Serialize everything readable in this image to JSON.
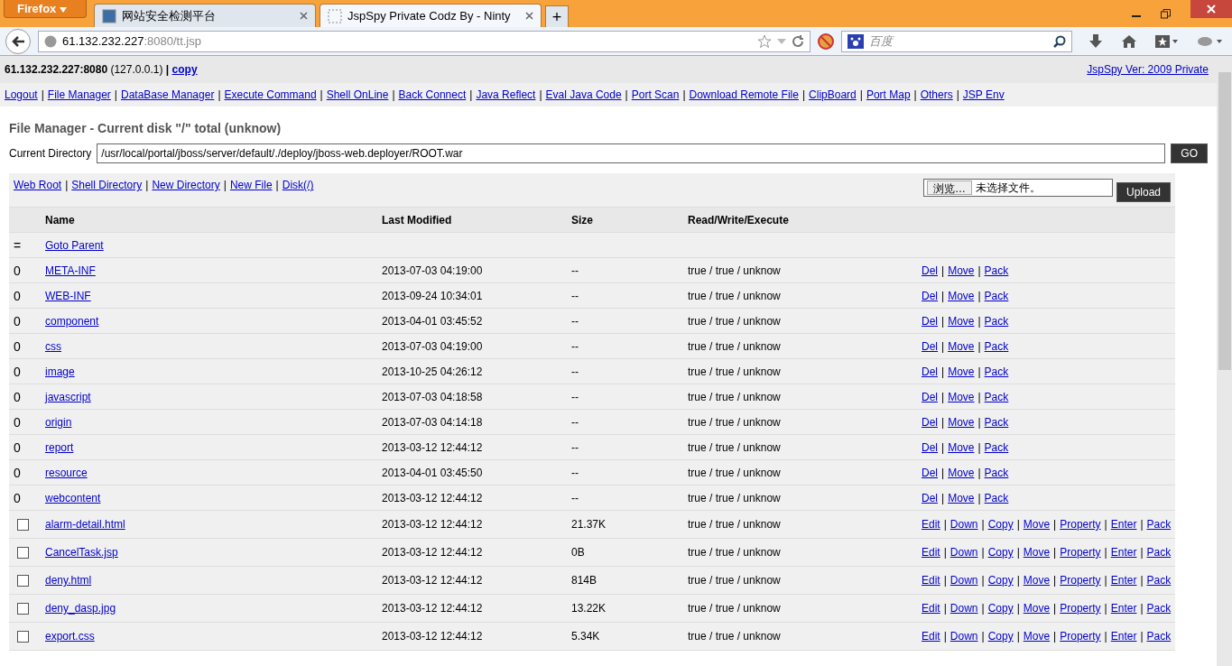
{
  "browser": {
    "menu_button": "Firefox",
    "tabs": [
      {
        "title": "网站安全检测平台",
        "selected": false
      },
      {
        "title": "JspSpy Private Codz By - Ninty",
        "selected": true
      }
    ],
    "new_tab": "+",
    "address": {
      "host": "61.132.232.227",
      "rest": ":8080/tt.jsp"
    },
    "search": {
      "placeholder": "百度"
    }
  },
  "header": {
    "host": "61.132.232.227:8080",
    "local": "(127.0.0.1)",
    "separator": "|",
    "copy_link": "copy",
    "version_link": "JspSpy Ver: 2009 Private"
  },
  "nav": {
    "separator": "|",
    "links": [
      "Logout",
      "File Manager",
      "DataBase Manager",
      "Execute Command",
      "Shell OnLine",
      "Back Connect",
      "Java Reflect",
      "Eval Java Code",
      "Port Scan",
      "Download Remote File",
      "ClipBoard",
      "Port Map",
      "Others",
      "JSP Env"
    ]
  },
  "title": "File Manager - Current disk \"/\" total (unknow)",
  "directory": {
    "label": "Current Directory",
    "value": "/usr/local/portal/jboss/server/default/./deploy/jboss-web.deployer/ROOT.war",
    "button": "GO"
  },
  "tools": {
    "separator": "|",
    "links": [
      "Web Root",
      "Shell Directory",
      "New Directory",
      "New File",
      "Disk(/)"
    ]
  },
  "upload": {
    "browse_button": "浏览…",
    "status": "未选择文件。",
    "button": "Upload"
  },
  "table": {
    "columns": [
      "Name",
      "Last Modified",
      "Size",
      "Read/Write/Execute"
    ],
    "parent": {
      "mark": "=",
      "link": "Goto Parent"
    },
    "action_separator": "|",
    "rows": [
      {
        "kind": "dir",
        "mark": "0",
        "name": "META-INF",
        "modified": "2013-07-03 04:19:00",
        "size": "--",
        "rwx": "true / true / unknow",
        "actions": [
          "Del",
          "Move",
          "Pack"
        ]
      },
      {
        "kind": "dir",
        "mark": "0",
        "name": "WEB-INF",
        "modified": "2013-09-24 10:34:01",
        "size": "--",
        "rwx": "true / true / unknow",
        "actions": [
          "Del",
          "Move",
          "Pack"
        ]
      },
      {
        "kind": "dir",
        "mark": "0",
        "name": "component",
        "modified": "2013-04-01 03:45:52",
        "size": "--",
        "rwx": "true / true / unknow",
        "actions": [
          "Del",
          "Move",
          "Pack"
        ]
      },
      {
        "kind": "dir",
        "mark": "0",
        "name": "css",
        "modified": "2013-07-03 04:19:00",
        "size": "--",
        "rwx": "true / true / unknow",
        "actions": [
          "Del",
          "Move",
          "Pack"
        ]
      },
      {
        "kind": "dir",
        "mark": "0",
        "name": "image",
        "modified": "2013-10-25 04:26:12",
        "size": "--",
        "rwx": "true / true / unknow",
        "actions": [
          "Del",
          "Move",
          "Pack"
        ]
      },
      {
        "kind": "dir",
        "mark": "0",
        "name": "javascript",
        "modified": "2013-07-03 04:18:58",
        "size": "--",
        "rwx": "true / true / unknow",
        "actions": [
          "Del",
          "Move",
          "Pack"
        ]
      },
      {
        "kind": "dir",
        "mark": "0",
        "name": "origin",
        "modified": "2013-07-03 04:14:18",
        "size": "--",
        "rwx": "true / true / unknow",
        "actions": [
          "Del",
          "Move",
          "Pack"
        ]
      },
      {
        "kind": "dir",
        "mark": "0",
        "name": "report",
        "modified": "2013-03-12 12:44:12",
        "size": "--",
        "rwx": "true / true / unknow",
        "actions": [
          "Del",
          "Move",
          "Pack"
        ]
      },
      {
        "kind": "dir",
        "mark": "0",
        "name": "resource",
        "modified": "2013-04-01 03:45:50",
        "size": "--",
        "rwx": "true / true / unknow",
        "actions": [
          "Del",
          "Move",
          "Pack"
        ]
      },
      {
        "kind": "dir",
        "mark": "0",
        "name": "webcontent",
        "modified": "2013-03-12 12:44:12",
        "size": "--",
        "rwx": "true / true / unknow",
        "actions": [
          "Del",
          "Move",
          "Pack"
        ]
      },
      {
        "kind": "file",
        "checked": false,
        "name": "alarm-detail.html",
        "modified": "2013-03-12 12:44:12",
        "size": "21.37K",
        "rwx": "true / true / unknow",
        "actions": [
          "Edit",
          "Down",
          "Copy",
          "Move",
          "Property",
          "Enter",
          "Pack"
        ]
      },
      {
        "kind": "file",
        "checked": false,
        "name": "CancelTask.jsp",
        "modified": "2013-03-12 12:44:12",
        "size": "0B",
        "rwx": "true / true / unknow",
        "actions": [
          "Edit",
          "Down",
          "Copy",
          "Move",
          "Property",
          "Enter",
          "Pack"
        ]
      },
      {
        "kind": "file",
        "checked": false,
        "name": "deny.html",
        "modified": "2013-03-12 12:44:12",
        "size": "814B",
        "rwx": "true / true / unknow",
        "actions": [
          "Edit",
          "Down",
          "Copy",
          "Move",
          "Property",
          "Enter",
          "Pack"
        ]
      },
      {
        "kind": "file",
        "checked": false,
        "name": "deny_dasp.jpg",
        "modified": "2013-03-12 12:44:12",
        "size": "13.22K",
        "rwx": "true / true / unknow",
        "actions": [
          "Edit",
          "Down",
          "Copy",
          "Move",
          "Property",
          "Enter",
          "Pack"
        ]
      },
      {
        "kind": "file",
        "checked": false,
        "name": "export.css",
        "modified": "2013-03-12 12:44:12",
        "size": "5.34K",
        "rwx": "true / true / unknow",
        "actions": [
          "Edit",
          "Down",
          "Copy",
          "Move",
          "Property",
          "Enter",
          "Pack"
        ]
      }
    ]
  }
}
